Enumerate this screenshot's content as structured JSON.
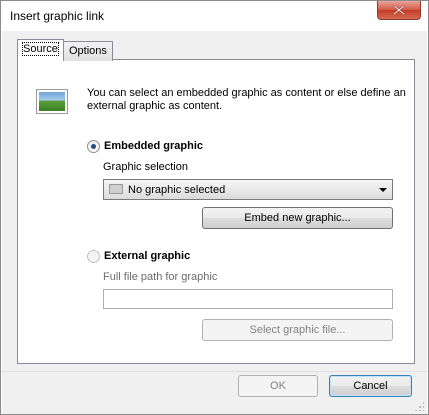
{
  "window": {
    "title": "Insert graphic link"
  },
  "tabs": [
    {
      "label": "Source",
      "active": true
    },
    {
      "label": "Options",
      "active": false
    }
  ],
  "source": {
    "intro_text": "You can select an embedded graphic as content or else define an external graphic as content.",
    "embedded": {
      "label": "Embedded graphic",
      "selected": true,
      "selection_label": "Graphic selection",
      "selection_value": "No graphic selected",
      "embed_button": "Embed new graphic..."
    },
    "external": {
      "label": "External graphic",
      "selected": false,
      "path_label": "Full file path for graphic",
      "path_value": "",
      "select_button": "Select graphic file..."
    }
  },
  "footer": {
    "ok_label": "OK",
    "cancel_label": "Cancel"
  },
  "icons": {
    "close": "close-icon",
    "graphic": "image-icon",
    "dropdown": "chevron-down-icon"
  },
  "colors": {
    "close_button": "#c23b24",
    "radio_dot": "#1d4f85"
  }
}
